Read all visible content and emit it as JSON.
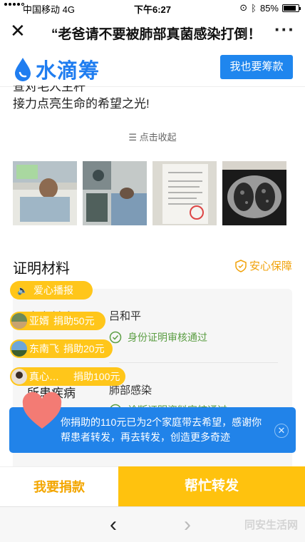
{
  "status_bar": {
    "carrier": "中国移动",
    "network": "4G",
    "time": "下午6:27",
    "battery": "85%",
    "battery_level": 0.85
  },
  "nav": {
    "title": "“老爸请不要被肺部真菌感染打倒！",
    "close_icon": "close-icon",
    "more_icon": "more-dots-icon"
  },
  "brand": {
    "name": "水滴筹",
    "raise_button": "我也要筹款",
    "accent": "#1f7df0"
  },
  "story": {
    "line1": "查对毛人生杆",
    "line2": "接力点亮生命的希望之光!"
  },
  "collapse_label": "点击收起",
  "photos": [
    "patient-in-bed",
    "patient-icu",
    "medical-document",
    "ct-scan"
  ],
  "materials": {
    "title": "证明材料",
    "guarantee": "安心保障",
    "rows": [
      {
        "label": "患者姓名",
        "value": "吕和平",
        "verified": "身份证明审核通过"
      },
      {
        "label": "所患疾病",
        "value": "肺部感染",
        "verified": "诊断证明资料审核通过"
      }
    ]
  },
  "badges": {
    "broadcast": "爱心播报",
    "donors": [
      {
        "name": "亚婿",
        "text": "捐助50元"
      },
      {
        "name": "东南飞",
        "text": "捐助20元"
      },
      {
        "name": "真心…",
        "text": "捐助100元"
      }
    ]
  },
  "toast": {
    "message": "你捐助的110元已为2个家庭带去希望，感谢你帮患者转发，再去转发，创造更多奇迹"
  },
  "actions": {
    "donate": "我要捐款",
    "share": "帮忙转发"
  },
  "browser": {
    "watermark": "同安生活网"
  }
}
